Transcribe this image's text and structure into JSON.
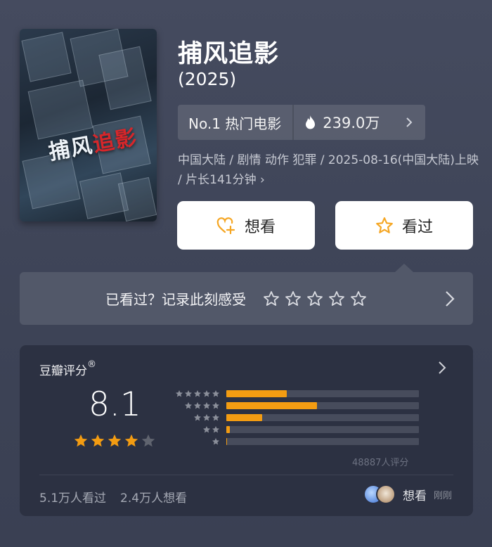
{
  "movie": {
    "title": "捕风追影",
    "year": "(2025)",
    "poster": {
      "title_left": "捕风",
      "title_right": "追影"
    }
  },
  "rank": {
    "label": "No.1 热门电影",
    "heat": "239.0万",
    "heat_icon": "flame-icon"
  },
  "meta": {
    "info": "中国大陆 / 剧情 动作 犯罪 / 2025-08-16(中国大陆)上映 / 片长141分钟 ›"
  },
  "actions": {
    "want_label": "想看",
    "seen_label": "看过"
  },
  "record": {
    "prompt": "已看过？记录此刻感受"
  },
  "rating": {
    "title": "豆瓣评分",
    "mark": "®",
    "score": "8.1",
    "stars": 4,
    "distribution_fractions": [
      0.315,
      0.47,
      0.185,
      0.02,
      0.005
    ],
    "count_text": "48887人评分"
  },
  "footer": {
    "watched": "5.1万人看过",
    "wanted": "2.4万人想看",
    "friend_action": "想看",
    "friend_time": "刚刚"
  },
  "colors": {
    "accent_orange": "#f39c12",
    "card_bg": "#2c3142",
    "bg": "#454b5f"
  }
}
